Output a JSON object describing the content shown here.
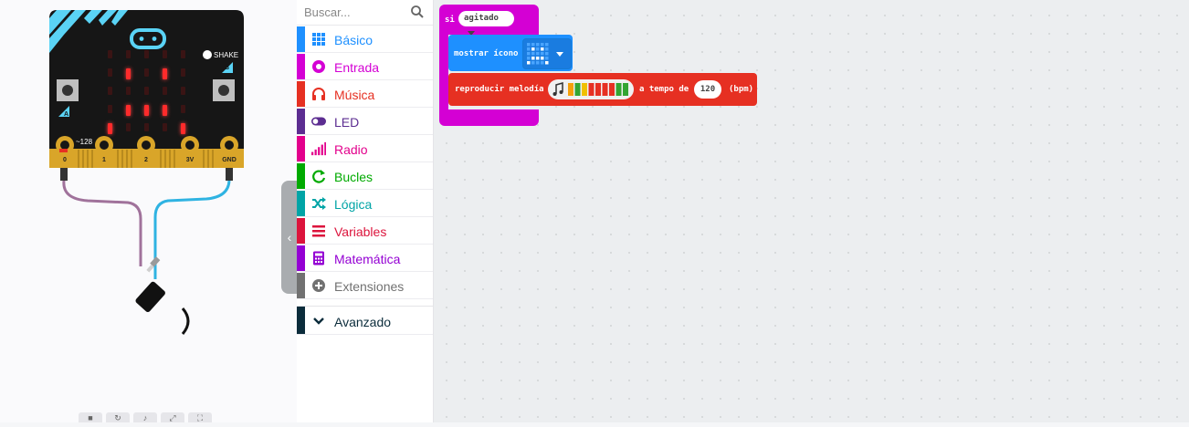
{
  "simulator": {
    "shake_label": "SHAKE",
    "button_a": "A",
    "button_b": "B",
    "pin_value": "~128",
    "pins": [
      "0",
      "1",
      "2",
      "3V",
      "GND"
    ],
    "led_matrix": [
      [
        0,
        0,
        0,
        0,
        0
      ],
      [
        0,
        1,
        0,
        1,
        0
      ],
      [
        0,
        0,
        0,
        0,
        0
      ],
      [
        0,
        1,
        1,
        1,
        0
      ],
      [
        1,
        0,
        0,
        0,
        1
      ]
    ],
    "collapse_glyph": "‹",
    "tools": [
      "■",
      "↻",
      "♪",
      "⤢",
      "⛶"
    ]
  },
  "toolbox": {
    "search": {
      "placeholder": "Buscar...",
      "icon": "search-icon"
    },
    "categories": [
      {
        "label": "Básico",
        "color": "#1e90ff",
        "icon": "grid-icon"
      },
      {
        "label": "Entrada",
        "color": "#d400d4",
        "icon": "target-icon"
      },
      {
        "label": "Música",
        "color": "#e63022",
        "icon": "headphones-icon"
      },
      {
        "label": "LED",
        "color": "#5c2d91",
        "icon": "toggle-icon"
      },
      {
        "label": "Radio",
        "color": "#e3008c",
        "icon": "signal-icon"
      },
      {
        "label": "Bucles",
        "color": "#00aa00",
        "icon": "loop-icon"
      },
      {
        "label": "Lógica",
        "color": "#00a4a6",
        "icon": "shuffle-icon"
      },
      {
        "label": "Variables",
        "color": "#dc143c",
        "icon": "list-icon"
      },
      {
        "label": "Matemática",
        "color": "#9400d3",
        "icon": "calculator-icon"
      },
      {
        "label": "Extensiones",
        "color": "#717171",
        "icon": "plus-circle-icon"
      }
    ],
    "advanced": {
      "label": "Avanzado",
      "color": "#0b2c3b",
      "icon": "chevron-down-icon"
    }
  },
  "blocks": {
    "event": {
      "keyword": "si",
      "gesture": "agitado",
      "color": "#d400d4"
    },
    "show_icon": {
      "label": "mostrar ícono",
      "color": "#1e90ff"
    },
    "play_melody": {
      "label": "reproducir melodía",
      "tempo_label": "a tempo de",
      "tempo_value": "120",
      "unit": "(bpm)",
      "color": "#e63022"
    },
    "melody_colors": [
      "#f5a00a",
      "#33a532",
      "#f0c000",
      "#e63022",
      "#e63022",
      "#e63022",
      "#e63022",
      "#33a532",
      "#33a532"
    ]
  }
}
